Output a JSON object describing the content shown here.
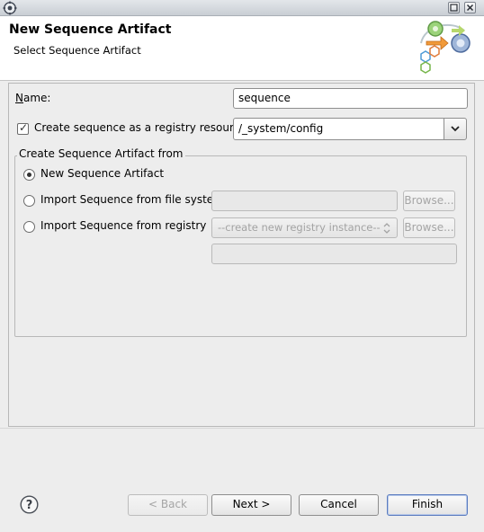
{
  "window": {
    "title_bar_icon": "eclipse-gear-icon",
    "controls": [
      "maximize-icon",
      "close-icon"
    ]
  },
  "banner": {
    "title": "New Sequence Artifact",
    "subtitle": "Select Sequence Artifact",
    "logo_icon": "sequence-wizard-icon"
  },
  "form": {
    "name_label": "Name:",
    "name_value": "sequence",
    "registry_checkbox_label": "Create sequence as a registry resource",
    "registry_checkbox_checked": true,
    "registry_path_value": "/_system/config",
    "group_title": "Create Sequence Artifact from",
    "options": [
      {
        "label": "New Sequence Artifact",
        "selected": true
      },
      {
        "label": "Import Sequence from file system",
        "selected": false
      },
      {
        "label": "Import Sequence from registry",
        "selected": false
      }
    ],
    "browse_label": "Browse...",
    "registry_instance_placeholder": "--create new registry instance--"
  },
  "footer": {
    "back_label": "< Back",
    "next_label": "Next >",
    "cancel_label": "Cancel",
    "finish_label": "Finish",
    "help_icon": "help-icon"
  }
}
